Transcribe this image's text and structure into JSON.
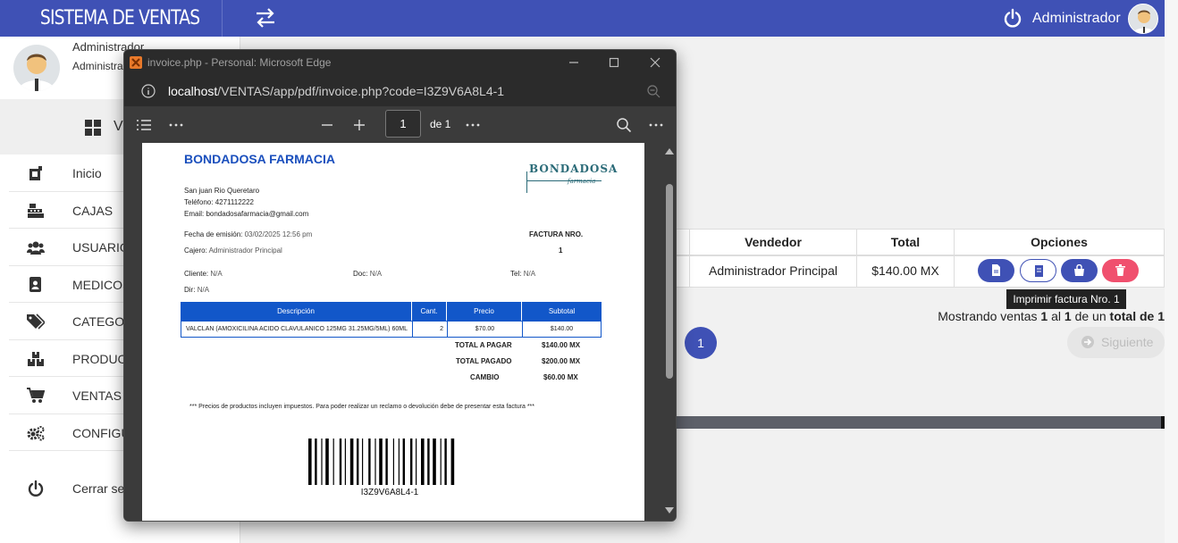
{
  "app": {
    "brand": "SISTEMA DE VENTAS",
    "top_user": "Administrador"
  },
  "sidebar": {
    "user_name": "Administrador",
    "user_role": "Administrad",
    "menu_title": "VE",
    "items": [
      {
        "label": "Inicio",
        "icon": "cash-register-icon"
      },
      {
        "label": "CAJAS",
        "icon": "cash-box-icon"
      },
      {
        "label": "USUARIOS",
        "icon": "users-icon"
      },
      {
        "label": "MEDICOS",
        "icon": "id-card-icon"
      },
      {
        "label": "CATEGORIA",
        "icon": "tags-icon"
      },
      {
        "label": "PRODUCTO",
        "icon": "boxes-icon"
      },
      {
        "label": "VENTAS",
        "icon": "cart-icon"
      },
      {
        "label": "CONFIGUR",
        "icon": "gears-icon"
      }
    ],
    "logout": "Cerrar sesi"
  },
  "sales_table": {
    "headers": [
      "Vendedor",
      "Total",
      "Opciones"
    ],
    "row": {
      "vendedor": "Administrador Principal",
      "total": "$140.00 MX"
    },
    "tooltip": "Imprimir factura Nro. 1",
    "summary": {
      "pre": "Mostrando ventas ",
      "from": "1",
      "mid1": " al ",
      "to": "1",
      "mid2": " de un ",
      "total_label": "total de 1"
    },
    "pager": {
      "page": "1",
      "next": "Siguiente"
    },
    "colors": {
      "primary": "#3f51b5",
      "danger": "#f0506e"
    }
  },
  "edge": {
    "title": "invoice.php - Personal: Microsoft Edge",
    "url_host": "localhost",
    "url_path": "/VENTAS/app/pdf/invoice.php?code=I3Z9V6A8L4-1",
    "page_num": "1",
    "page_of": "de 1"
  },
  "invoice": {
    "company": "BONDADOSA FARMACIA",
    "logo_text": "BONDADOSA",
    "logo_sub": "farmacia",
    "address": "San juan Rio Queretaro",
    "phone": "Teléfono: 4271112222",
    "email": "Email: bondadosafarmacia@gmail.com",
    "date_label": "Fecha de emisión:",
    "date": "03/02/2025 12:56 pm",
    "cashier_label": "Cajero:",
    "cashier": "Administrador Principal",
    "factura_label": "FACTURA NRO.",
    "factura_num": "1",
    "client_label": "Cliente:",
    "client": "N/A",
    "doc_label": "Doc:",
    "doc": "N/A",
    "tel_label": "Tel:",
    "tel": "N/A",
    "dir_label": "Dir:",
    "dir": "N/A",
    "cols": [
      "Descripción",
      "Cant.",
      "Precio",
      "Subtotal"
    ],
    "item": {
      "desc": "VALCLAN (AMOXICILINA ACIDO CLAVULANICO 125MG 31.25MG/5ML) 60ML",
      "qty": "2",
      "price": "$70.00",
      "subtotal": "$140.00"
    },
    "total_pagar_label": "TOTAL A PAGAR",
    "total_pagar": "$140.00 MX",
    "total_pagado_label": "TOTAL PAGADO",
    "total_pagado": "$200.00 MX",
    "cambio_label": "CAMBIO",
    "cambio": "$60.00 MX",
    "note": "*** Precios de productos incluyen impuestos. Para poder realizar un reclamo o devolución debe de presentar esta factura ***",
    "barcode": "I3Z9V6A8L4-1"
  }
}
